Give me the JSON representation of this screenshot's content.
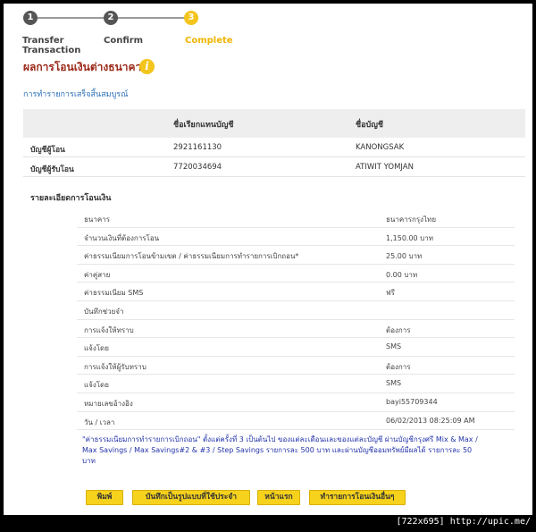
{
  "steps": [
    {
      "num": "1",
      "label": "Transfer\nTransaction"
    },
    {
      "num": "2",
      "label": "Confirm"
    },
    {
      "num": "3",
      "label": "Complete"
    }
  ],
  "page_title": "ผลการโอนเงินต่างธนาคาร",
  "success_message": "การทำรายการเสร็จสิ้นสมบูรณ์",
  "accounts": {
    "headers": [
      "",
      "ชื่อเรียกแทนบัญชี",
      "ชื่อบัญชี"
    ],
    "rows": [
      {
        "label": "บัญชีผู้โอน",
        "number": "2921161130",
        "name": "KANONGSAK"
      },
      {
        "label": "บัญชีผู้รับโอน",
        "number": "7720034694",
        "name": "ATIWIT YOMJAN"
      }
    ]
  },
  "details_title": "รายละเอียดการโอนเงิน",
  "details": [
    {
      "label": "ธนาคาร",
      "value": "ธนาคารกรุงไทย"
    },
    {
      "label": "จำนวนเงินที่ต้องการโอน",
      "value": "1,150.00 บาท"
    },
    {
      "label": "ค่าธรรมเนียมการโอนข้ามเขต / ค่าธรรมเนียมการทำรายการเบิกถอน",
      "required": "*",
      "value": "25.00 บาท"
    },
    {
      "label": "ค่าคู่สาย",
      "value": "0.00 บาท"
    },
    {
      "label": "ค่าธรรมเนียม SMS",
      "value": "ฟรี"
    },
    {
      "label": "บันทึกช่วยจำ",
      "value": ""
    },
    {
      "label": "การแจ้งให้ทราบ",
      "value": "ต้องการ"
    },
    {
      "label": "แจ้งโดย",
      "value": "SMS"
    },
    {
      "label": "การแจ้งให้ผู้รับทราบ",
      "value": "ต้องการ"
    },
    {
      "label": "แจ้งโดย",
      "value": "SMS"
    },
    {
      "label": "หมายเลขอ้างอิง",
      "value": "bayi55709344"
    },
    {
      "label": "วัน / เวลา",
      "value": "06/02/2013 08:25:09 AM"
    }
  ],
  "note": "\"ค่าธรรมเนียมการทำรายการเบิกถอน\" ตั้งแต่ครั้งที่ 3 เป็นต้นไป ของแต่ละเดือนและของแต่ละบัญชี ผ่านบัญชีกรุงศรี Mix & Max / Max Savings / Max Savings#2 & #3 / Step Savings รายการละ 500 บาท และผ่านบัญชีออมทรัพย์มีผลได้ รายการละ 50 บาท",
  "buttons": {
    "print": "พิมพ์",
    "save_template": "บันทึกเป็นรูปแบบที่ใช้ประจำ",
    "home": "หน้าแรก",
    "other_transfer": "ทำรายการโอนเงินอื่นๆ"
  },
  "footer": "[722x695] http://upic.me/",
  "colors": {
    "accent": "#f3c41c",
    "title": "#9c2a1a",
    "link": "#2a6fb5"
  }
}
